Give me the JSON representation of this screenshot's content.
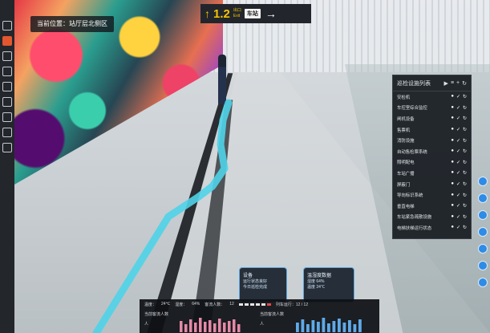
{
  "location": {
    "text": "当前位置：站厅层北侧区"
  },
  "top_sign": {
    "left_arrow": "↑",
    "number": "1.2",
    "sub_top": "出口",
    "sub_bottom": "Exit",
    "box_text": "车站",
    "right_arrow": "→"
  },
  "left_toolbar": {
    "icons": [
      "home-icon",
      "clipboard-icon",
      "layers-icon",
      "camera-icon",
      "pin-icon",
      "list-icon",
      "menu-icon",
      "video-icon",
      "settings-icon"
    ]
  },
  "panel": {
    "title": "巡检设施列表",
    "controls": [
      "▶",
      "≡",
      "+",
      "↻"
    ],
    "rows": [
      "安检机",
      "车控室综合监控",
      "闸机设备",
      "售票机",
      "消防设施",
      "自动售检票系统",
      "照明配电",
      "车站广播",
      "屏蔽门",
      "导向标识系统",
      "垂直电梯",
      "车站紧急疏散设施",
      "电梯扶梯运行状态"
    ]
  },
  "cards": [
    {
      "title": "设备",
      "line1": "运行状态良好",
      "line2": "今日巡检完成"
    },
    {
      "title": "温湿度数据",
      "line1": "湿度 64%",
      "line2": "温度 24℃"
    }
  ],
  "stats": {
    "labels": [
      "温度：",
      "湿度：",
      "客流人数：",
      "列车运行：12 / 12"
    ],
    "values": [
      "24℃",
      "64%",
      "12"
    ],
    "series_left_label": "当前客流人数",
    "series_right_label": "当前客流人数",
    "series_left_unit": "人",
    "series_right_unit": "人"
  },
  "colors": {
    "accent": "#e2572f",
    "route": "#4fd3e8",
    "fab": "#2e8be6",
    "bar_left": "#e58aa6",
    "bar_right": "#5fa9e8"
  }
}
